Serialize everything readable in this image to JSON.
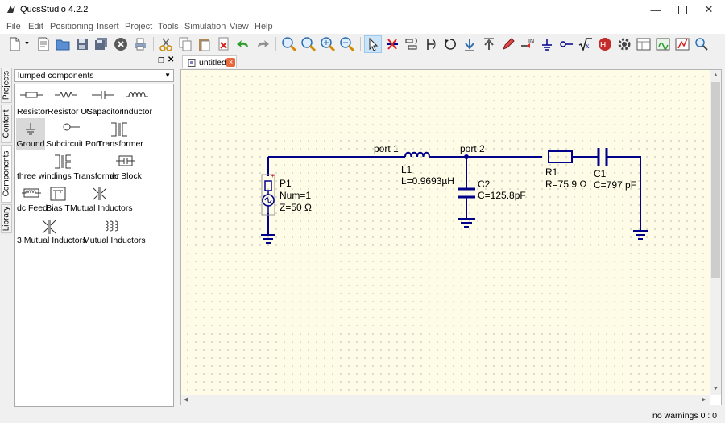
{
  "window": {
    "title": "QucsStudio 4.2.2"
  },
  "menu": [
    "File",
    "Edit",
    "Positioning",
    "Insert",
    "Project",
    "Tools",
    "Simulation",
    "View",
    "Help"
  ],
  "dock": {
    "category": "lumped components",
    "side_tabs": [
      "Projects",
      "Content",
      "Components",
      "Library"
    ],
    "components": [
      {
        "label": "Resistor",
        "icon": "resistor-icon"
      },
      {
        "label": "Resistor US",
        "icon": "resistor-us-icon"
      },
      {
        "label": "Capacitor",
        "icon": "capacitor-icon"
      },
      {
        "label": "Inductor",
        "icon": "inductor-icon"
      },
      {
        "label": "Ground",
        "icon": "ground-icon"
      },
      {
        "label": "Subcircuit Port",
        "icon": "subcircuit-port-icon"
      },
      {
        "label": "Transformer",
        "icon": "transformer-icon"
      },
      {
        "label": "three windings Transformer",
        "icon": "three-winding-transformer-icon"
      },
      {
        "label": "dc Block",
        "icon": "dc-block-icon"
      },
      {
        "label": "dc Feed",
        "icon": "dc-feed-icon"
      },
      {
        "label": "Bias T",
        "icon": "bias-t-icon"
      },
      {
        "label": "Mutual Inductors",
        "icon": "mutual-inductors-icon"
      },
      {
        "label": "3 Mutual Inductors",
        "icon": "three-mutual-inductors-icon"
      },
      {
        "label": "Mutual Inductors",
        "icon": "mutual-inductors-multi-icon"
      }
    ]
  },
  "document": {
    "tab_label": "untitled",
    "close_glyph": "×"
  },
  "schematic": {
    "wire_labels": {
      "port1": "port 1",
      "port2": "port 2"
    },
    "P1": {
      "name": "P1",
      "num": "Num=1",
      "z": "Z=50 Ω"
    },
    "L1": {
      "name": "L1",
      "value": "L=0.9693µH"
    },
    "C2": {
      "name": "C2",
      "value": "C=125.8pF"
    },
    "R1": {
      "name": "R1",
      "value": "R=75.9 Ω"
    },
    "C1": {
      "name": "C1",
      "value": "C=797 pF"
    }
  },
  "status": {
    "text": "no warnings  0 : 0"
  },
  "colors": {
    "wire": "#00008b",
    "canvas_bg": "#fefbe6",
    "selection": "#d9d9d9",
    "close_orange": "#e8663c"
  }
}
